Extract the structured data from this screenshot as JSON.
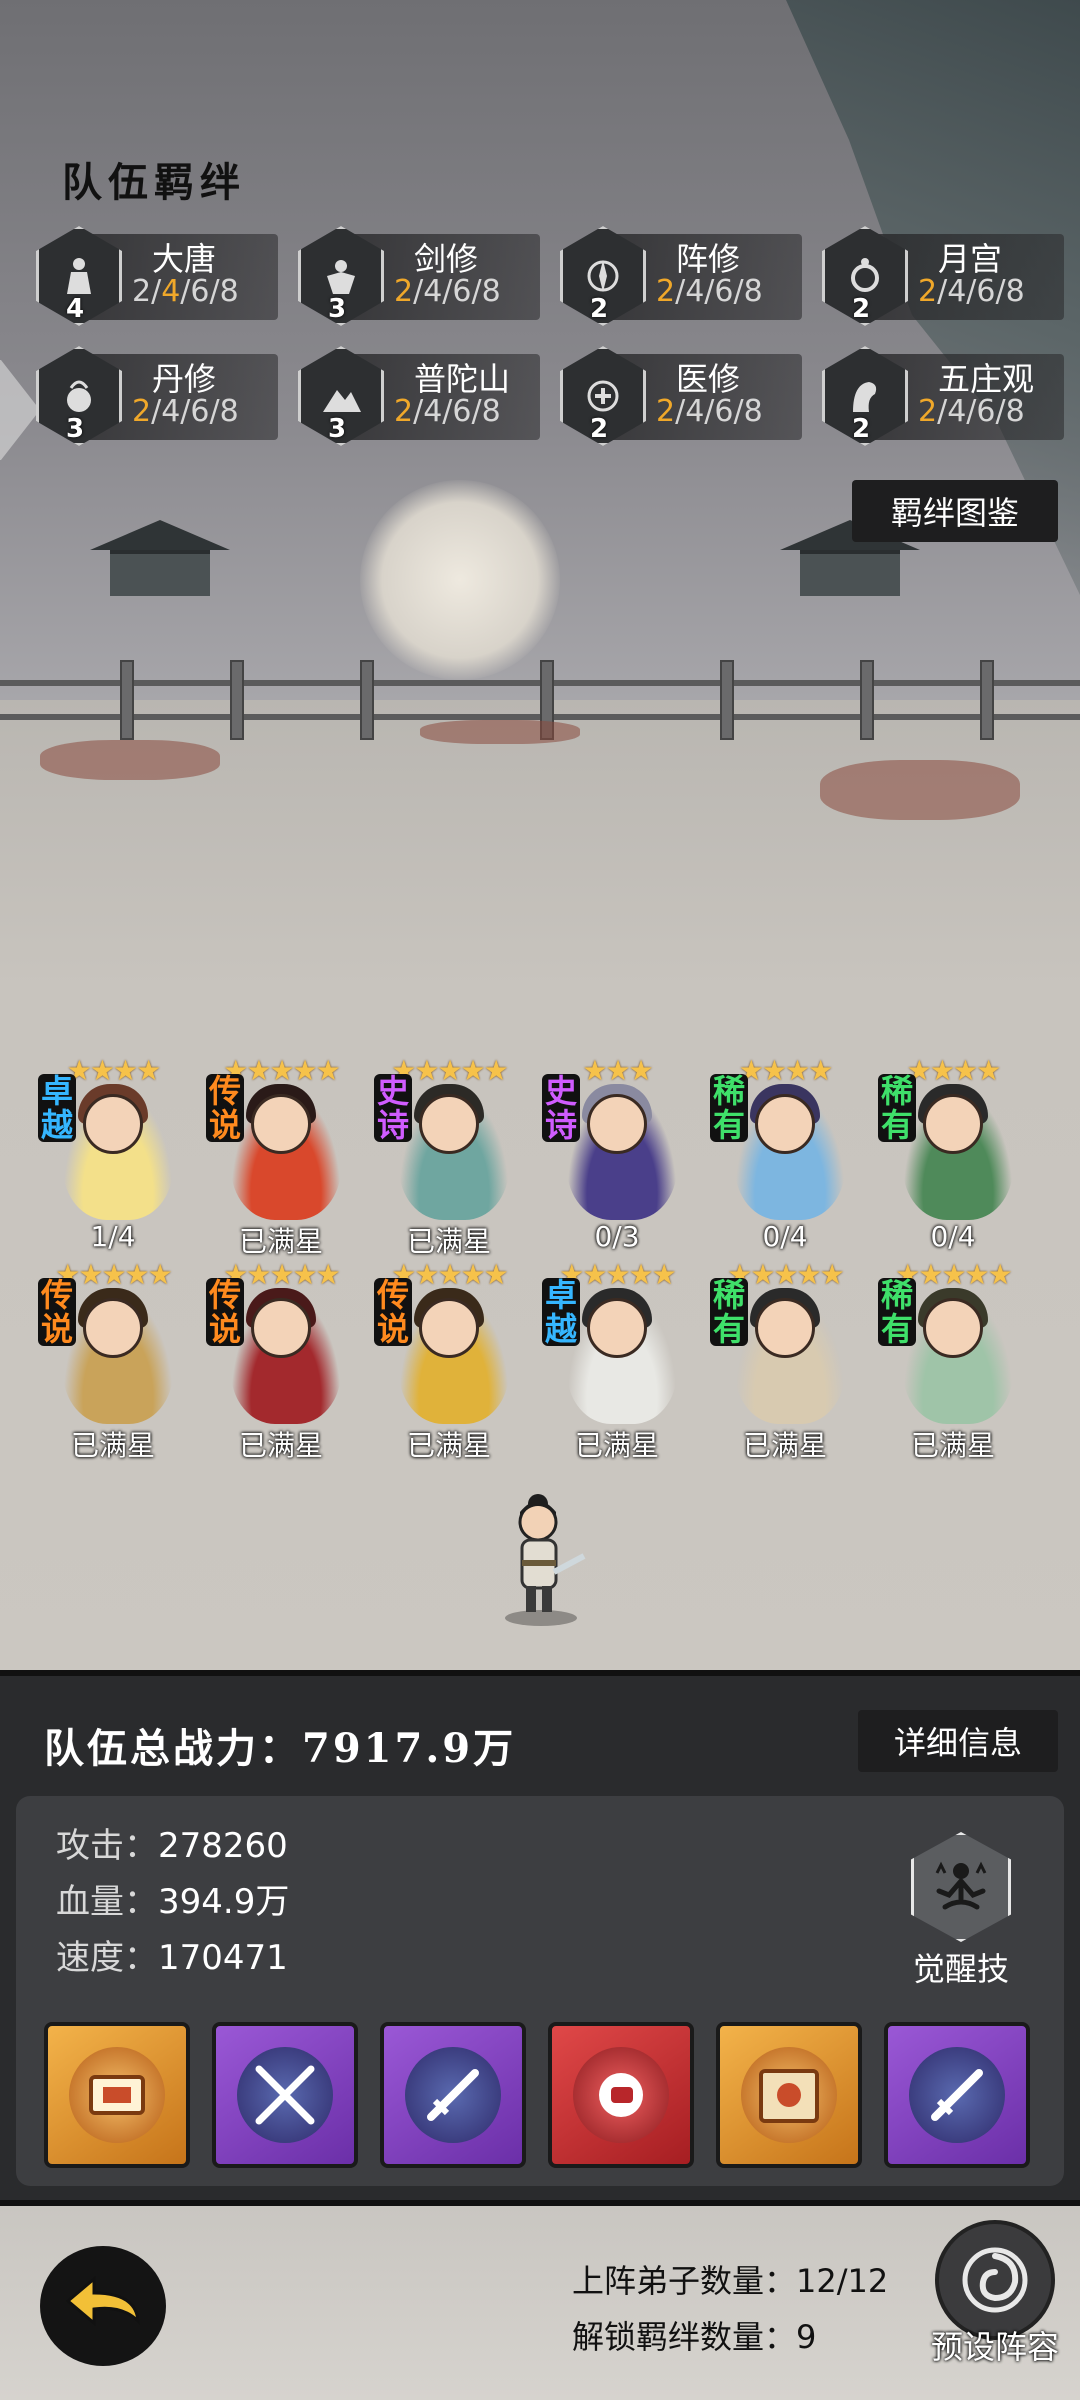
{
  "bonds": {
    "title": "队伍羁绊",
    "items": [
      {
        "name": "大唐",
        "count": "4",
        "tier1": "2",
        "sep1": "/",
        "tier2": "4",
        "rest": "/6/8",
        "highlight": 2,
        "icon": "warrior-icon"
      },
      {
        "name": "剑修",
        "count": "3",
        "tier1": "2",
        "rest": "/4/6/8",
        "highlight": 1,
        "icon": "sword-cultivator-icon"
      },
      {
        "name": "阵修",
        "count": "2",
        "tier1": "2",
        "rest": "/4/6/8",
        "highlight": 1,
        "icon": "formation-icon"
      },
      {
        "name": "月宫",
        "count": "2",
        "tier1": "2",
        "rest": "/4/6/8",
        "highlight": 1,
        "icon": "moon-palace-icon"
      },
      {
        "name": "丹修",
        "count": "3",
        "tier1": "2",
        "rest": "/4/6/8",
        "highlight": 1,
        "icon": "alchemy-icon"
      },
      {
        "name": "普陀山",
        "count": "3",
        "tier1": "2",
        "rest": "/4/6/8",
        "highlight": 1,
        "icon": "mountain-icon"
      },
      {
        "name": "医修",
        "count": "2",
        "tier1": "2",
        "rest": "/4/6/8",
        "highlight": 1,
        "icon": "healer-icon"
      },
      {
        "name": "五庄观",
        "count": "2",
        "tier1": "2",
        "rest": "/4/6/8",
        "highlight": 1,
        "icon": "temple-icon"
      }
    ],
    "codex_button": "羁绊图鉴"
  },
  "heroes": [
    {
      "rarity": "卓越",
      "rarity_color": "#35b6ff",
      "stars": "★★★★",
      "caption": "1/4",
      "robe": "#f3e08a",
      "hair": "#6a3b2a"
    },
    {
      "rarity": "传说",
      "rarity_color": "#ff8a1e",
      "stars": "★★★★★",
      "caption": "已满星",
      "robe": "#d9482c",
      "hair": "#2a1a18"
    },
    {
      "rarity": "史诗",
      "rarity_color": "#d05cff",
      "stars": "★★★★★",
      "caption": "已满星",
      "robe": "#6fa6a0",
      "hair": "#2c2a26"
    },
    {
      "rarity": "史诗",
      "rarity_color": "#d05cff",
      "stars": "★★★",
      "caption": "0/3",
      "robe": "#4a3f8a",
      "hair": "#8a8aa0"
    },
    {
      "rarity": "稀有",
      "rarity_color": "#3fe06a",
      "stars": "★★★★",
      "caption": "0/4",
      "robe": "#7db6e0",
      "hair": "#3a3560"
    },
    {
      "rarity": "稀有",
      "rarity_color": "#3fe06a",
      "stars": "★★★★",
      "caption": "0/4",
      "robe": "#4f8a5a",
      "hair": "#2a2a2a"
    },
    {
      "rarity": "传说",
      "rarity_color": "#ff8a1e",
      "stars": "★★★★★",
      "caption": "已满星",
      "robe": "#c9a35a",
      "hair": "#3a2a1a"
    },
    {
      "rarity": "传说",
      "rarity_color": "#ff8a1e",
      "stars": "★★★★★",
      "caption": "已满星",
      "robe": "#a3292d",
      "hair": "#4a1a1a"
    },
    {
      "rarity": "传说",
      "rarity_color": "#ff8a1e",
      "stars": "★★★★★",
      "caption": "已满星",
      "robe": "#e0b23a",
      "hair": "#3a2a1a"
    },
    {
      "rarity": "卓越",
      "rarity_color": "#35b6ff",
      "stars": "★★★★★",
      "caption": "已满星",
      "robe": "#e8e8e4",
      "hair": "#2a2a2a"
    },
    {
      "rarity": "稀有",
      "rarity_color": "#3fe06a",
      "stars": "★★★★★",
      "caption": "已满星",
      "robe": "#d8cab0",
      "hair": "#2a2a2a"
    },
    {
      "rarity": "稀有",
      "rarity_color": "#3fe06a",
      "stars": "★★★★★",
      "caption": "已满星",
      "robe": "#9fc4a8",
      "hair": "#3a3a2a"
    }
  ],
  "panel": {
    "power_label": "队伍总战力：7917.9万",
    "detail_button": "详细信息",
    "stats": [
      {
        "label": "攻击：",
        "value": "278260"
      },
      {
        "label": "血量：",
        "value": "394.9万"
      },
      {
        "label": "速度：",
        "value": "170471"
      }
    ],
    "awaken_label": "觉醒技",
    "skills": [
      {
        "style": "gold",
        "icon": "scroll-badge-icon"
      },
      {
        "style": "purple",
        "icon": "crossed-swords-icon"
      },
      {
        "style": "purple",
        "icon": "sword-emblem-icon"
      },
      {
        "style": "red",
        "icon": "fist-crest-icon"
      },
      {
        "style": "gold",
        "icon": "book-icon"
      },
      {
        "style": "purple",
        "icon": "sword-emblem-icon"
      }
    ]
  },
  "footer": {
    "deployed_label": "上阵弟子数量：",
    "deployed_value": "12/12",
    "bonds_label": "解锁羁绊数量：",
    "bonds_value": "9",
    "preset_label": "预设阵容"
  }
}
